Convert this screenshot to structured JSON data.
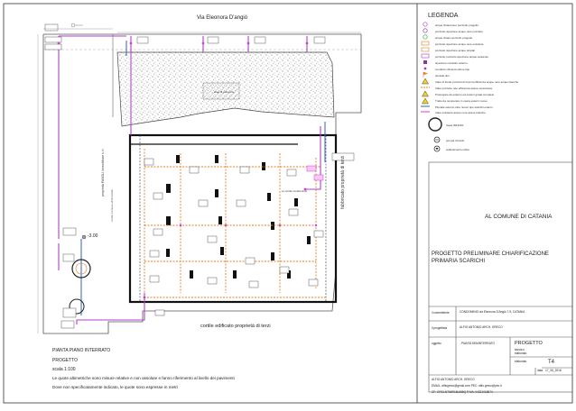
{
  "street_top": "Via Eleonora D'angiò",
  "legend": {
    "title": "LEGENDA",
    "items": [
      {
        "label": "acque chiare/nere pozzetto progetto",
        "icon": "pink-ring-icon",
        "color": "#c040c0"
      },
      {
        "label": "pozzetto ispezione acque nere pozzetto",
        "icon": "purple-ring-icon",
        "color": "#8030a0"
      },
      {
        "label": "acque chiare pozzetto progetto",
        "icon": "green-ring-icon",
        "color": "#40a040"
      },
      {
        "label": "pozzetto ispezione acque nere esistente",
        "icon": "orange-rect-icon",
        "color": "#e08020"
      },
      {
        "label": "pozzetto ispezione acque pluviali",
        "icon": "orange-rect-icon-2",
        "color": "#e08020"
      },
      {
        "label": "pozzetto pozzetto ispezione acque esistente",
        "icon": "purple-rect-icon",
        "color": "#a040c0"
      },
      {
        "label": "ispezione condotto esterno",
        "icon": "purple-square-icon",
        "color": "#9030b0"
      },
      {
        "label": "condotto chiusura sifone tipo",
        "icon": "purple-dot-icon",
        "color": "#a040c0"
      },
      {
        "label": "pluviale tipo",
        "icon": "flag-icon",
        "color": "#e08020"
      },
      {
        "label": "tratto di fondo pozzetti di ricerca efficienza acque nere acque bianche",
        "icon": "warning-icon",
        "color": "#e0c000"
      },
      {
        "label": "tratto pozzetto rete efficienza acque nere/acque",
        "icon": "orange-line-icon",
        "color": "#e08020"
      },
      {
        "label": "Prolungare da esterno ed esterni grado completo",
        "icon": "warning-icon-2",
        "color": "#e0c000"
      },
      {
        "label": "Tratto da recuperare in opera esterni nuovo",
        "icon": "warning-icon-3",
        "color": "#e0c000"
      },
      {
        "label": "Pluviale esterno tubo nuovo tipo scarichi esterni",
        "icon": "blue-line-icon",
        "color": "#3060c0"
      },
      {
        "label": "tratto esistente acque nere acque bianche",
        "icon": "pink-line-icon",
        "color": "#d040d0"
      },
      {
        "label": "fossa IMHOFF",
        "icon": "big-circle-icon",
        "color": "#222222"
      },
      {
        "label": "pompa ricircolo",
        "icon": "pump-icon",
        "color": "#222222"
      },
      {
        "label": "sollevamento reflue",
        "icon": "lift-icon",
        "color": "#222222"
      }
    ]
  },
  "plan_labels": {
    "right_side": "ex cortile condominio",
    "right_side_2": "fabbricato proprietà di terzi",
    "left_side": "proprietà PASOLI immobiliare s.r.l.",
    "left_side_2": "cortile comune all'immobile",
    "bottom": "cortile edificato proprietà di terzi",
    "elevation": "-3.00",
    "hatched_area": "area di manovra"
  },
  "notes": {
    "line1": "PIANTA PIANO INTERRATO",
    "line2": "PROGETTO",
    "line3": "scala 1:100",
    "line4": "Le quote altimetriche sono misure relative e non assolute e fanno riferimento al livello dei pavimenti",
    "line5": "Dove non specificatamente indicato, le quote sono espresse in metri"
  },
  "title_block": {
    "authority": "AL COMUNE DI CATANIA",
    "project_title": "PROGETTO PRELIMINARE CHIARIFICAZIONE PRIMARIA SCARICHI",
    "committente_label": "il committente",
    "committente_value": "CONDOMINIO via Eleonora D'Angiò 7-9, CATANIA",
    "progettista_label": "il progettista",
    "progettista_value": "ALFIO ANTONIO ARCH. GRECO",
    "oggetto_label": "oggetto",
    "oggetto_value": "- PIANTA SEMINTERRATO",
    "doc_type": "PROGETTO",
    "doc_sub": "tavola n.",
    "doc_sub2": "elaborato",
    "tav_label": "elaborato",
    "tav_value": "T4",
    "data_label": "data",
    "data_value": "17_06_2016",
    "footer_1": "ALFIO ANTONIO ARCH. GRECO",
    "footer_2": "EMAIL: alfiogreco@gmail.com  PEC: alfio.greco@pec.it",
    "footer_3": "CF: GRCLNT66R18L685Q  P.IVA: 04321018874"
  }
}
